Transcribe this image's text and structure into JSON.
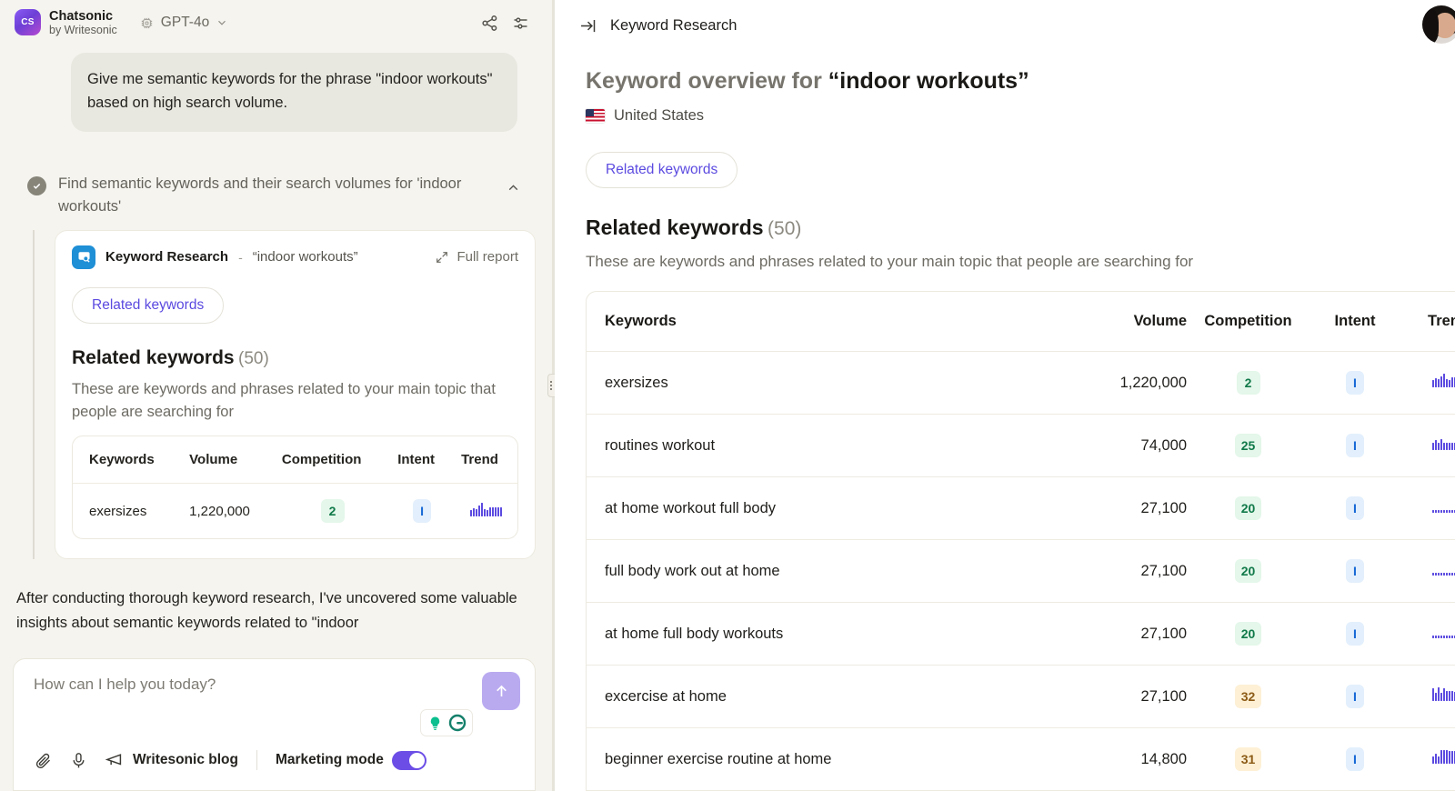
{
  "left": {
    "brand": {
      "name": "Chatsonic",
      "sub": "by Writesonic",
      "logo_text": "CS"
    },
    "model": {
      "label": "GPT-4o"
    },
    "header_actions": {
      "share": "share-icon",
      "settings": "settings-icon"
    },
    "user_message": "Give me semantic keywords for the phrase \"indoor workouts\" based on high search volume.",
    "task": {
      "label": "Find semantic keywords and their search volumes for 'indoor workouts'",
      "state": "completed"
    },
    "tool_card": {
      "title": "Keyword Research",
      "dash": "-",
      "query": "“indoor workouts”",
      "full_report": "Full report",
      "pill": "Related keywords",
      "section_title": "Related keywords",
      "section_count": "(50)",
      "section_desc": "These are keywords and phrases related to your main topic that people are searching for",
      "columns": [
        "Keywords",
        "Volume",
        "Competition",
        "Intent",
        "Trend"
      ],
      "rows": [
        {
          "keyword": "exersizes",
          "volume": "1,220,000",
          "competition": "2",
          "competition_level": "green",
          "intent": "I",
          "trend": [
            6,
            8,
            7,
            10,
            13,
            7,
            6,
            9,
            9,
            9,
            9,
            9
          ]
        }
      ]
    },
    "assistant_text": "After conducting thorough keyword research, I've uncovered some valuable insights about semantic keywords related to \"indoor",
    "composer": {
      "placeholder": "How can I help you today?",
      "send": "send-icon",
      "attach": "paperclip-icon",
      "mic": "microphone-icon",
      "blog_label": "Writesonic blog",
      "mode_label": "Marketing mode",
      "mode_on": true
    }
  },
  "right": {
    "breadcrumb": "Keyword Research",
    "title_prefix": "Keyword overview for",
    "title_query": "“indoor workouts”",
    "country": "United States",
    "pill": "Related keywords",
    "section_title": "Related keywords",
    "section_count": "(50)",
    "section_desc": "These are keywords and phrases related to your main topic that people are searching for",
    "columns": [
      "Keywords",
      "Volume",
      "Competition",
      "Intent",
      "Trend"
    ],
    "rows": [
      {
        "keyword": "exersizes",
        "volume": "1,220,000",
        "competition": "2",
        "competition_level": "green",
        "intent": "I",
        "trend": [
          7,
          9,
          8,
          11,
          14,
          8,
          7,
          10,
          10,
          10,
          10,
          10
        ]
      },
      {
        "keyword": "routines workout",
        "volume": "74,000",
        "competition": "25",
        "competition_level": "green",
        "intent": "I",
        "trend": [
          6,
          8,
          6,
          9,
          6,
          6,
          6,
          6,
          6,
          7,
          8,
          11
        ]
      },
      {
        "keyword": "at home workout full body",
        "volume": "27,100",
        "competition": "20",
        "competition_level": "green",
        "intent": "I",
        "trend": [
          2,
          2,
          2,
          2,
          2,
          2,
          2,
          2,
          2,
          2,
          3,
          11
        ]
      },
      {
        "keyword": "full body work out at home",
        "volume": "27,100",
        "competition": "20",
        "competition_level": "green",
        "intent": "I",
        "trend": [
          2,
          2,
          2,
          2,
          2,
          2,
          2,
          2,
          2,
          2,
          3,
          11
        ]
      },
      {
        "keyword": "at home full body workouts",
        "volume": "27,100",
        "competition": "20",
        "competition_level": "green",
        "intent": "I",
        "trend": [
          2,
          2,
          2,
          2,
          2,
          2,
          2,
          2,
          2,
          2,
          3,
          11
        ]
      },
      {
        "keyword": "excercise at home",
        "volume": "27,100",
        "competition": "32",
        "competition_level": "yellow",
        "intent": "I",
        "trend": [
          11,
          7,
          12,
          7,
          11,
          9,
          9,
          9,
          8,
          7,
          7,
          8
        ]
      },
      {
        "keyword": "beginner exercise routine at home",
        "volume": "14,800",
        "competition": "31",
        "competition_level": "yellow",
        "intent": "I",
        "trend": [
          6,
          8,
          6,
          11,
          11,
          11,
          10,
          10,
          10,
          9,
          7,
          6
        ]
      }
    ]
  },
  "colors": {
    "accent_purple": "#5b4ae0",
    "brand_gradient_start": "#8b5cf6",
    "competition_green_bg": "#e4f7ea",
    "competition_green_fg": "#11794a",
    "competition_yellow_bg": "#fdf0d5",
    "competition_yellow_fg": "#8c5b16",
    "intent_bg": "#e3effc",
    "intent_fg": "#1668d6",
    "left_panel_bg": "#f5f4ef",
    "user_bubble_bg": "#e9e8e0"
  }
}
